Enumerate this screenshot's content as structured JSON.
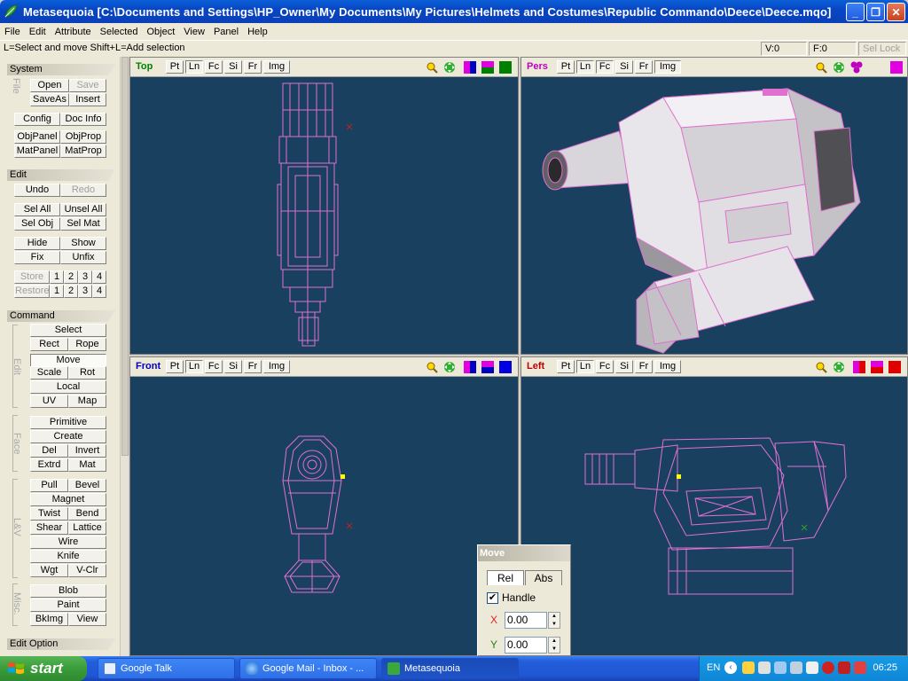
{
  "window": {
    "title": "Metasequoia [C:\\Documents and Settings\\HP_Owner\\My Documents\\My Pictures\\Helmets and Costumes\\Republic Commando\\Deece\\Deece.mqo]",
    "minimize": "_",
    "maximize": "❐",
    "close": "✕"
  },
  "menu": [
    "File",
    "Edit",
    "Attribute",
    "Selected",
    "Object",
    "View",
    "Panel",
    "Help"
  ],
  "status": {
    "hint": "L=Select and move  Shift+L=Add selection",
    "v": "V:0",
    "f": "F:0",
    "sel_lock": "Sel Lock"
  },
  "left_panel": {
    "system": {
      "title": "System",
      "file_label": "File",
      "open": "Open",
      "save": "Save",
      "saveas": "SaveAs",
      "insert": "Insert",
      "config": "Config",
      "docinfo": "Doc Info",
      "objpanel": "ObjPanel",
      "objprop": "ObjProp",
      "matpanel": "MatPanel",
      "matprop": "MatProp"
    },
    "edit": {
      "title": "Edit",
      "undo": "Undo",
      "redo": "Redo",
      "selall": "Sel All",
      "unselall": "Unsel All",
      "selobj": "Sel Obj",
      "selmat": "Sel Mat",
      "hide": "Hide",
      "show": "Show",
      "fix": "Fix",
      "unfix": "Unfix",
      "store": "Store",
      "restore": "Restore",
      "n1": "1",
      "n2": "2",
      "n3": "3",
      "n4": "4"
    },
    "command": {
      "title": "Command",
      "edit_label": "Edit",
      "select": "Select",
      "rect": "Rect",
      "rope": "Rope",
      "move": "Move",
      "scale": "Scale",
      "rot": "Rot",
      "local": "Local",
      "uv": "UV",
      "map": "Map",
      "face_label": "Face",
      "primitive": "Primitive",
      "create": "Create",
      "del": "Del",
      "invert": "Invert",
      "extrd": "Extrd",
      "mat": "Mat",
      "lv_label": "L&V",
      "pull": "Pull",
      "bevel": "Bevel",
      "magnet": "Magnet",
      "twist": "Twist",
      "bend": "Bend",
      "shear": "Shear",
      "lattice": "Lattice",
      "wire": "Wire",
      "knife": "Knife",
      "wgt": "Wgt",
      "vclr": "V-Clr",
      "misc_label": "Misc.",
      "blob": "Blob",
      "paint": "Paint",
      "bkimg": "BkImg",
      "view": "View"
    },
    "edit_option": {
      "title": "Edit Option"
    }
  },
  "viewports": {
    "top": {
      "name": "Top",
      "name_color": "#008000",
      "buttons": [
        "Pt",
        "Ln",
        "Fc",
        "Si",
        "Fr",
        "Img"
      ]
    },
    "pers": {
      "name": "Pers",
      "name_color": "#c000c0",
      "buttons": [
        "Pt",
        "Ln",
        "Fc",
        "Si",
        "Fr",
        "Img"
      ]
    },
    "front": {
      "name": "Front",
      "name_color": "#0000c0",
      "buttons": [
        "Pt",
        "Ln",
        "Fc",
        "Si",
        "Fr",
        "Img"
      ]
    },
    "left": {
      "name": "Left",
      "name_color": "#c00000",
      "buttons": [
        "Pt",
        "Ln",
        "Fc",
        "Si",
        "Fr",
        "Img"
      ]
    }
  },
  "move_panel": {
    "title": "Move",
    "tab_rel": "Rel",
    "tab_abs": "Abs",
    "handle_check": "✔",
    "handle_label": "Handle",
    "x_label": "X",
    "x_value": "0.00",
    "y_label": "Y",
    "y_value": "0.00"
  },
  "taskbar": {
    "start": "start",
    "tasks": [
      "Google Talk",
      "Google Mail - Inbox - ...",
      "Metasequoia"
    ],
    "lang": "EN",
    "clock": "06:25"
  },
  "colors": {
    "viewport_bg": "#1a4060",
    "wire": "#e070d0",
    "model_face": "#e8e6ea"
  }
}
